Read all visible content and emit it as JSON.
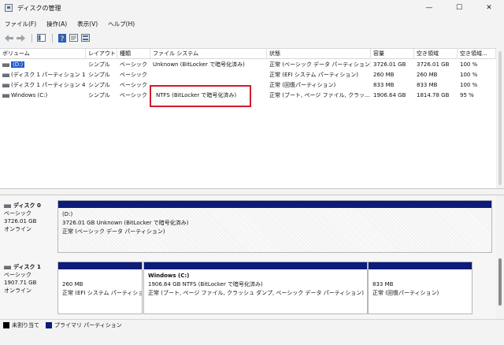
{
  "window": {
    "title": "ディスクの管理",
    "controls": {
      "minimize": "—",
      "maximize": "☐",
      "close": "✕"
    }
  },
  "menu": [
    "ファイル(F)",
    "操作(A)",
    "表示(V)",
    "ヘルプ(H)"
  ],
  "toolbar": {
    "icons": [
      "back-arrow-icon",
      "forward-arrow-icon",
      "view-panel-icon",
      "help-icon",
      "properties-icon",
      "disk-view-icon"
    ]
  },
  "volume_list": {
    "headers": [
      "ボリューム",
      "レイアウト",
      "種類",
      "ファイル システム",
      "状態",
      "容量",
      "空き領域",
      "空き領域..."
    ],
    "rows": [
      {
        "name": "(D:)",
        "layout": "シンプル",
        "type": "ベーシック",
        "fs": "Unknown (BitLocker で暗号化済み)",
        "status": "正常 (ベーシック データ パーティション)",
        "capacity": "3726.01 GB",
        "free": "3726.01 GB",
        "free_pct": "100 %"
      },
      {
        "name": "(ディスク 1 パーティション 1)",
        "layout": "シンプル",
        "type": "ベーシック",
        "fs": "",
        "status": "正常 (EFI システム パーティション)",
        "capacity": "260 MB",
        "free": "260 MB",
        "free_pct": "100 %"
      },
      {
        "name": "(ディスク 1 パーティション 4)",
        "layout": "シンプル",
        "type": "ベーシック",
        "fs": "",
        "status": "正常 (回復パーティション)",
        "capacity": "833 MB",
        "free": "833 MB",
        "free_pct": "100 %"
      },
      {
        "name": "Windows (C:)",
        "layout": "シンプル",
        "type": "ベーシック",
        "fs": "NTFS (BitLocker で暗号化済み)",
        "status": "正常 (ブート, ページ ファイル, クラッ...",
        "capacity": "1906.64 GB",
        "free": "1814.78 GB",
        "free_pct": "95 %"
      }
    ]
  },
  "disks": [
    {
      "name": "ディスク 0",
      "type": "ベーシック",
      "size": "3726.01 GB",
      "state": "オンライン",
      "partitions": [
        {
          "title": "(D:)",
          "line1": "3726.01 GB Unknown (BitLocker で暗号化済み)",
          "line2": "正常 (ベーシック データ パーティション)"
        }
      ]
    },
    {
      "name": "ディスク 1",
      "type": "ベーシック",
      "size": "1907.71 GB",
      "state": "オンライン",
      "partitions": [
        {
          "title": "",
          "line1": "260 MB",
          "line2": "正常 (EFI システム パーティショ"
        },
        {
          "title": "Windows  (C:)",
          "line1": "1906.64 GB NTFS (BitLocker で暗号化済み)",
          "line2": "正常 (ブート, ページ ファイル, クラッシュ ダンプ, ベーシック データ パーティション)"
        },
        {
          "title": "",
          "line1": "833 MB",
          "line2": "正常 (回復パーティション)"
        }
      ]
    }
  ],
  "legend": [
    {
      "label": "未割り当て",
      "color": "#000000"
    },
    {
      "label": "プライマリ パーティション",
      "color": "#0d1b7a"
    }
  ],
  "colors": {
    "partition_bar": "#0d1b7a",
    "highlight": "#d21b2a",
    "selection": "#1d59c8"
  }
}
